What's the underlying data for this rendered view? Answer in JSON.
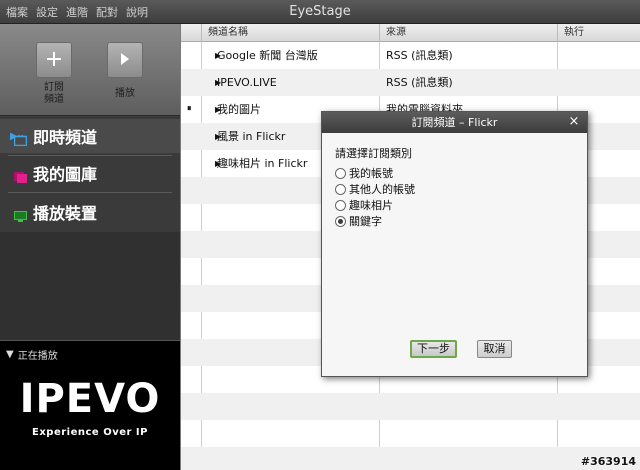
{
  "menubar": {
    "items": [
      "檔案",
      "設定",
      "進階",
      "配對",
      "說明"
    ],
    "title": "EyeStage"
  },
  "toolbar": {
    "subscribe_label": "訂閱\n頻道",
    "play_label": "播放"
  },
  "sidebar": {
    "items": [
      {
        "label": "即時頻道",
        "icon": "tv-icon",
        "color": "#3fa0e8"
      },
      {
        "label": "我的圖庫",
        "icon": "photo-library-icon",
        "color": "#e0208c"
      },
      {
        "label": "播放裝置",
        "icon": "monitor-icon",
        "color": "#3cc040"
      }
    ]
  },
  "now_playing": {
    "title": "正在播放",
    "logo": "IPEVO",
    "tagline": "Experience Over IP"
  },
  "table": {
    "headers": [
      "頻道名稱",
      "來源",
      "執行"
    ],
    "rows": [
      {
        "name": "Google 新聞 台灣版",
        "source": "RSS (訊息類)",
        "status": ""
      },
      {
        "name": "IPEVO.LIVE",
        "source": "RSS (訊息類)",
        "status": ""
      },
      {
        "name": "我的圖片",
        "source": "我的電腦資料夾",
        "status": "⏸"
      },
      {
        "name": "風景 in Flickr",
        "source": "",
        "status": ""
      },
      {
        "name": "趣味相片 in Flickr",
        "source": "",
        "status": ""
      }
    ]
  },
  "dialog": {
    "title": "訂閱頻道 – Flickr",
    "close": "×",
    "prompt": "請選擇訂閱類別",
    "options": [
      {
        "label": "我的帳號",
        "selected": false
      },
      {
        "label": "其他人的帳號",
        "selected": false
      },
      {
        "label": "趣味相片",
        "selected": false
      },
      {
        "label": "關鍵字",
        "selected": true
      }
    ],
    "next_label": "下一步",
    "cancel_label": "取消"
  },
  "watermark": "#363914",
  "colors": {
    "accent_blue": "#3fa0e8",
    "library_pink": "#e0208c",
    "device_green": "#3cc040",
    "next_border": "#6ea84a"
  }
}
